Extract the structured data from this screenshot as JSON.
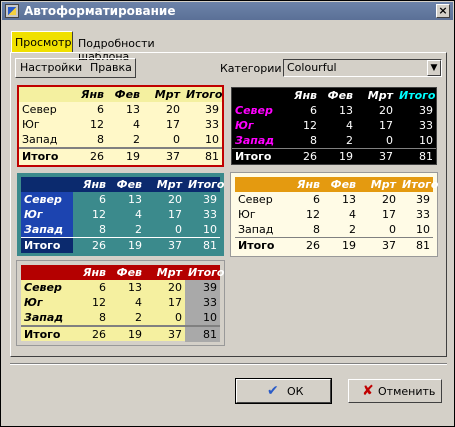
{
  "window": {
    "title": "Автоформатирование",
    "close_label": "×"
  },
  "tabs": [
    {
      "label": "Просмотр"
    },
    {
      "label": "Подробности шаблона"
    }
  ],
  "subtabs": [
    {
      "label": "Настройки"
    },
    {
      "label": "Правка"
    }
  ],
  "category": {
    "label": "Категории",
    "value": "Colourful"
  },
  "table": {
    "headers": [
      "",
      "Янв",
      "Фев",
      "Мрт",
      "Итого"
    ],
    "rows": [
      [
        "Север",
        "6",
        "13",
        "20",
        "39"
      ],
      [
        "Юг",
        "12",
        "4",
        "17",
        "33"
      ],
      [
        "Запад",
        "8",
        "2",
        "0",
        "10"
      ],
      [
        "Итого",
        "26",
        "19",
        "37",
        "81"
      ]
    ]
  },
  "buttons": {
    "ok_label": "ОК",
    "cancel_label": "Отменить"
  },
  "colors": {
    "sample1_header": "#f4f0a0",
    "sample1_body": "#fff8c8",
    "sample1_border": "#c00000",
    "sample2_bg": "#000000",
    "sample2_header": "#00ffff",
    "sample2_rows": "#ff00ff",
    "sample3_header": "#0b2a6e",
    "sample3_side": "#1c44b0",
    "sample3_body": "#3b8a8c",
    "sample4_header": "#e49a10",
    "sample4_body": "#fffbe6",
    "sample5_header": "#b40000",
    "sample5_body": "#f5f0a0",
    "sample5_total": "#a9a9a9"
  }
}
